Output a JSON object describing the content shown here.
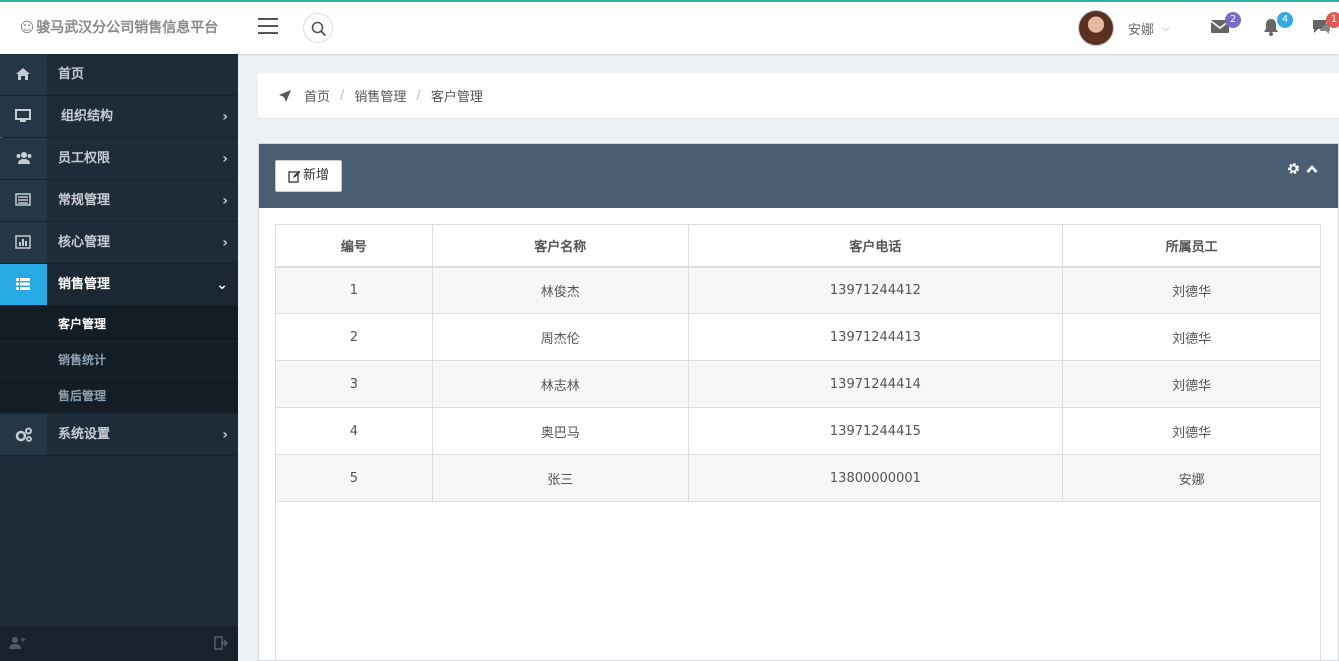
{
  "app": {
    "title": "骏马武汉分公司销售信息平台",
    "smile": "☺"
  },
  "header": {
    "user_name": "安娜",
    "caret": "⌵",
    "notifications": [
      {
        "name": "mail",
        "count": "2",
        "color": "#7b6bc8"
      },
      {
        "name": "bell",
        "count": "4",
        "color": "#33a9dd"
      },
      {
        "name": "chat",
        "count": "1",
        "color": "#e05a5a"
      }
    ]
  },
  "sidebar": {
    "items": [
      {
        "label": "首页",
        "icon": "home-icon",
        "arrow": ""
      },
      {
        "label": "组织结构",
        "icon": "monitor-icon",
        "arrow": "›"
      },
      {
        "label": "员工权限",
        "icon": "users-icon",
        "arrow": "›"
      },
      {
        "label": "常规管理",
        "icon": "list-alt-icon",
        "arrow": "›"
      },
      {
        "label": "核心管理",
        "icon": "bar-chart-icon",
        "arrow": "›"
      },
      {
        "label": "销售管理",
        "icon": "list-icon",
        "arrow": "⌄"
      },
      {
        "label": "系统设置",
        "icon": "cogs-icon",
        "arrow": "›"
      }
    ],
    "sub_items": [
      "客户管理",
      "销售统计",
      "售后管理"
    ]
  },
  "breadcrumb": {
    "items": [
      "首页",
      "销售管理",
      "客户管理"
    ],
    "separator": "/"
  },
  "panel": {
    "add_label": "新增"
  },
  "table": {
    "headers": [
      "编号",
      "客户名称",
      "客户电话",
      "所属员工"
    ],
    "rows": [
      [
        "1",
        "林俊杰",
        "13971244412",
        "刘德华"
      ],
      [
        "2",
        "周杰伦",
        "13971244413",
        "刘德华"
      ],
      [
        "3",
        "林志林",
        "13971244414",
        "刘德华"
      ],
      [
        "4",
        "奥巴马",
        "13971244415",
        "刘德华"
      ],
      [
        "5",
        "张三",
        "13800000001",
        "安娜"
      ]
    ]
  },
  "colors": {
    "accent": "#27a9e3",
    "sidebar_bg": "#1e2c39",
    "panel_head": "#4b5d71",
    "top_border": "#2bb3a8"
  }
}
